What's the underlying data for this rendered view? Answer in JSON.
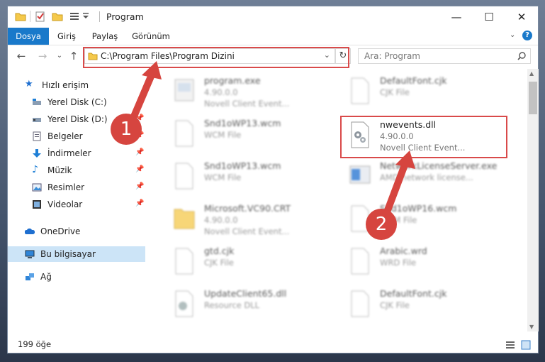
{
  "window": {
    "title": "Program"
  },
  "ribbon": {
    "tabs": [
      {
        "label": "Dosya",
        "active": true
      },
      {
        "label": "Giriş",
        "active": false
      },
      {
        "label": "Paylaş",
        "active": false
      },
      {
        "label": "Görünüm",
        "active": false
      }
    ]
  },
  "address": {
    "path": "C:\\Program Files\\Program Dizini"
  },
  "search": {
    "placeholder": "Ara: Program"
  },
  "sidebar": {
    "quick_access": "Hızlı erişim",
    "items": [
      {
        "label": "Yerel Disk (C:)",
        "icon": "drive-icon",
        "pinned": true
      },
      {
        "label": "Yerel Disk (D:)",
        "icon": "drive-icon",
        "pinned": true
      },
      {
        "label": "Belgeler",
        "icon": "documents-icon",
        "pinned": true
      },
      {
        "label": "İndirmeler",
        "icon": "download-icon",
        "pinned": true
      },
      {
        "label": "Müzik",
        "icon": "music-icon",
        "pinned": true
      },
      {
        "label": "Resimler",
        "icon": "pictures-icon",
        "pinned": true
      },
      {
        "label": "Videolar",
        "icon": "videos-icon",
        "pinned": true
      }
    ],
    "onedrive": "OneDrive",
    "this_pc": "Bu bilgisayar",
    "network": "Ağ"
  },
  "files": {
    "left": [
      {
        "name": "program.exe",
        "line2": "4.90.0.0",
        "line3": "Novell Client Event..."
      },
      {
        "name": "Snd1oWP13.wcm",
        "line2": "WCM File",
        "line3": ""
      },
      {
        "name": "Snd1oWP13.wcm",
        "line2": "WCM File",
        "line3": ""
      },
      {
        "name": "Microsoft.VC90.CRT",
        "line2": "4.90.0.0",
        "line3": "Novell Client Event..."
      },
      {
        "name": "gtd.cjk",
        "line2": "CJK File",
        "line3": ""
      },
      {
        "name": "UpdateClient65.dll",
        "line2": "Resource DLL",
        "line3": ""
      }
    ],
    "right": [
      {
        "name": "DefaultFont.cjk",
        "line2": "CJK File",
        "line3": ""
      },
      {
        "name": "nwevents.dll",
        "line2": "4.90.0.0",
        "line3": "Novell Client Event..."
      },
      {
        "name": "NetworkLicenseServer.exe",
        "line2": "AMD network license...",
        "line3": ""
      },
      {
        "name": "Snd1oWP16.wcm",
        "line2": "WCM File",
        "line3": ""
      },
      {
        "name": "Arabic.wrd",
        "line2": "WRD File",
        "line3": ""
      },
      {
        "name": "DefaultFont.cjk",
        "line2": "CJK File",
        "line3": ""
      }
    ]
  },
  "status": {
    "count": "199 öğe"
  },
  "markers": {
    "one": "1",
    "two": "2"
  },
  "colors": {
    "accent": "#1979ca",
    "highlight": "#d94a4a"
  }
}
